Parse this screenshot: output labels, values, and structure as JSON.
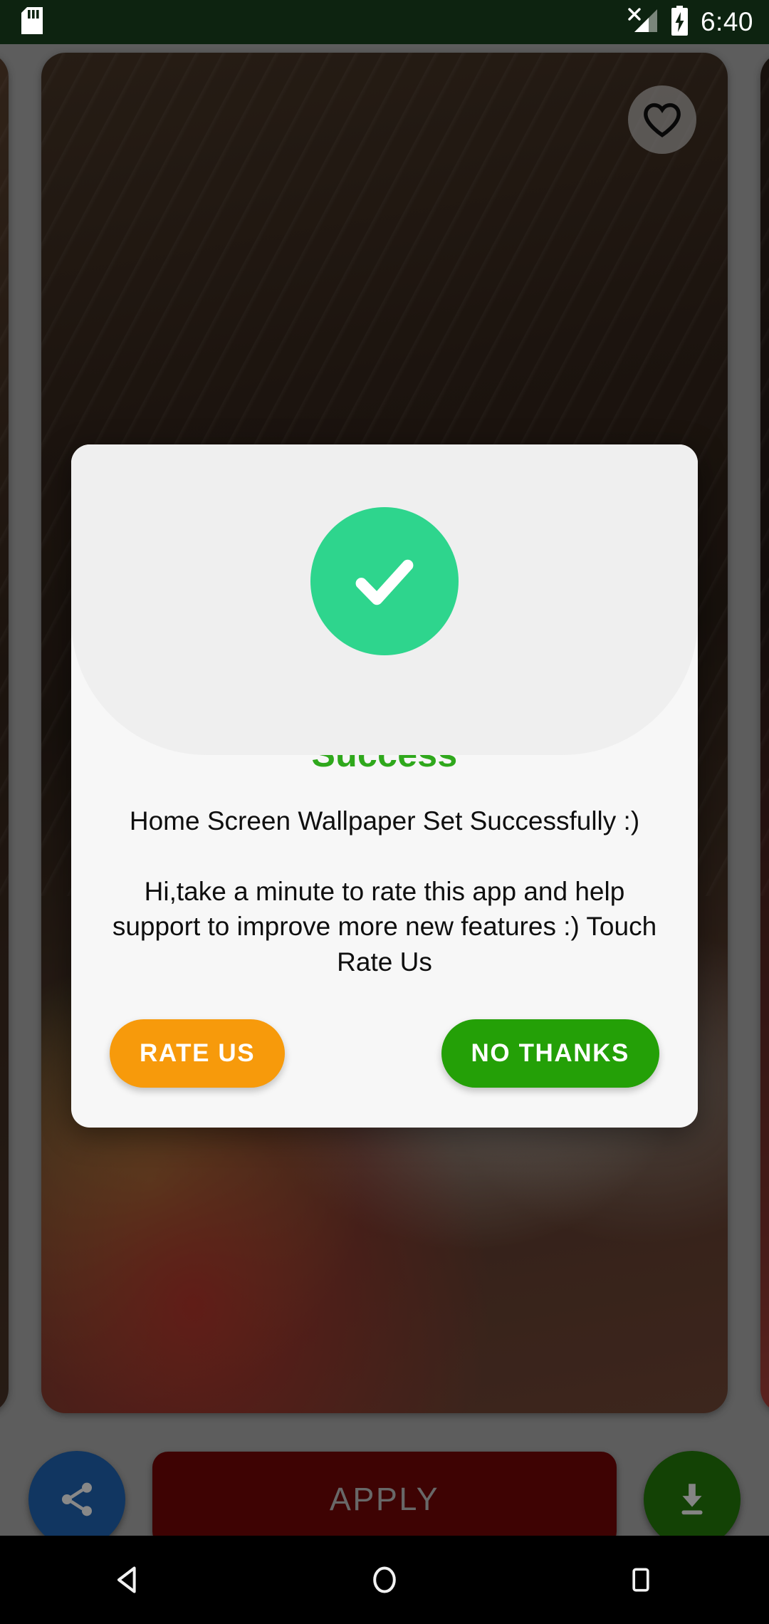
{
  "status_bar": {
    "background_color": "#0d2310",
    "time": "6:40",
    "icons": [
      {
        "name": "sd-card-icon",
        "position": "left"
      },
      {
        "name": "signal-no-sim-icon",
        "position": "right"
      },
      {
        "name": "battery-charging-icon",
        "position": "right"
      }
    ]
  },
  "wallpaper_screen": {
    "favorite_label": "heart-icon",
    "cards": [
      {
        "name": "wallpaper-card-previous",
        "position": "left"
      },
      {
        "name": "wallpaper-card-current",
        "position": "center"
      },
      {
        "name": "wallpaper-card-next",
        "position": "right"
      }
    ]
  },
  "bottom_bar": {
    "share_label": "share-icon",
    "apply_label": "APPLY",
    "apply_color": "#5e0606",
    "download_label": "download-icon",
    "share_color": "#1b5393",
    "download_color": "#1d6408"
  },
  "dialog": {
    "icon": "check-circle-icon",
    "icon_color": "#2ed58d",
    "title": "Success",
    "title_color": "#2fa81c",
    "message": "Home Screen Wallpaper Set Successfully :)",
    "submessage": "Hi,take a minute to rate this app and help support to improve more new features :) Touch Rate Us",
    "primary_button": "RATE US",
    "primary_button_color": "#f79a0b",
    "secondary_button": "NO THANKS",
    "secondary_button_color": "#24a007"
  },
  "nav_bar": {
    "back_label": "back-icon",
    "home_label": "home-icon",
    "recents_label": "recents-icon"
  }
}
